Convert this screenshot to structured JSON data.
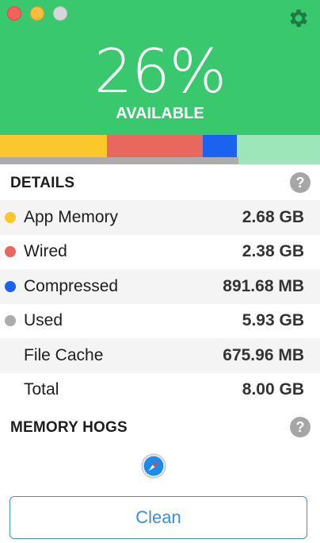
{
  "window": {
    "traffic_lights": [
      "close",
      "minimize",
      "maximize"
    ],
    "settings_icon": "gear-icon"
  },
  "summary": {
    "percent": "26%",
    "label": "AVAILABLE",
    "available_fraction": 0.26
  },
  "usage_bar": {
    "segments": [
      {
        "name": "App Memory",
        "color": "#fbc72c",
        "value_gb": 2.68
      },
      {
        "name": "Wired",
        "color": "#e8685e",
        "value_gb": 2.38
      },
      {
        "name": "Compressed",
        "color": "#1a62ef",
        "value_gb": 0.87
      },
      {
        "name": "Free",
        "color": "#9de6bc",
        "value_gb": 2.07
      }
    ]
  },
  "details": {
    "title": "DETAILS",
    "help_label": "?",
    "rows": [
      {
        "label": "App Memory",
        "value": "2.68 GB",
        "bullet_color": "#fbc72c"
      },
      {
        "label": "Wired",
        "value": "2.38 GB",
        "bullet_color": "#e8685e"
      },
      {
        "label": "Compressed",
        "value": "891.68 MB",
        "bullet_color": "#1a62ef"
      },
      {
        "label": "Used",
        "value": "5.93 GB",
        "bullet_color": "#acacac"
      },
      {
        "label": "File Cache",
        "value": "675.96 MB",
        "bullet_color": ""
      },
      {
        "label": "Total",
        "value": "8.00 GB",
        "bullet_color": ""
      }
    ]
  },
  "hogs": {
    "title": "MEMORY HOGS",
    "help_label": "?",
    "apps": [
      {
        "icon": "safari-icon"
      }
    ]
  },
  "actions": {
    "clean_label": "Clean"
  },
  "colors": {
    "header_green": "#3ac86e",
    "accent_blue": "#3a8fdc"
  }
}
